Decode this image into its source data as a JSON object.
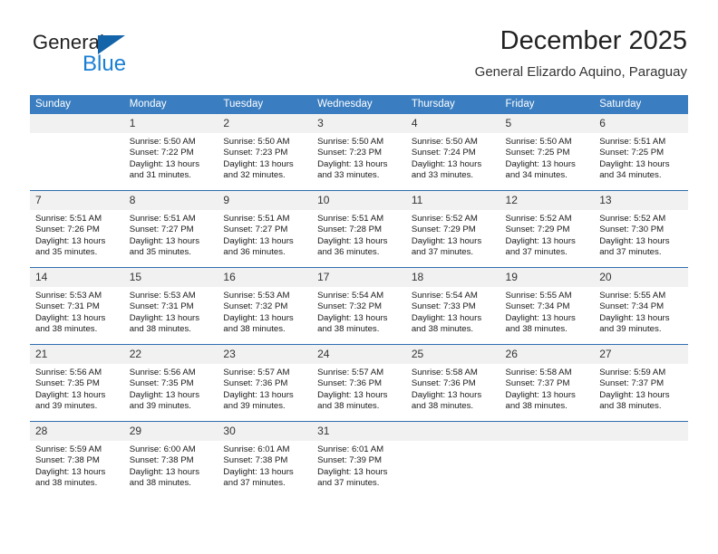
{
  "logo": {
    "word_one": "General",
    "word_two": "Blue",
    "triangle_color": "#1464aa",
    "blue_color": "#1a7fd4"
  },
  "header": {
    "title": "December 2025",
    "subtitle": "General Elizardo Aquino, Paraguay"
  },
  "theme": {
    "header_row_bg": "#3a7dc0",
    "daynum_bg": "#f1f1f1",
    "row_divider": "#2f6fb0"
  },
  "weekdays": [
    "Sunday",
    "Monday",
    "Tuesday",
    "Wednesday",
    "Thursday",
    "Friday",
    "Saturday"
  ],
  "weeks": [
    [
      {
        "day": "",
        "sunrise": "",
        "sunset": "",
        "daylight_line1": "",
        "daylight_line2": ""
      },
      {
        "day": "1",
        "sunrise": "Sunrise: 5:50 AM",
        "sunset": "Sunset: 7:22 PM",
        "daylight_line1": "Daylight: 13 hours",
        "daylight_line2": "and 31 minutes."
      },
      {
        "day": "2",
        "sunrise": "Sunrise: 5:50 AM",
        "sunset": "Sunset: 7:23 PM",
        "daylight_line1": "Daylight: 13 hours",
        "daylight_line2": "and 32 minutes."
      },
      {
        "day": "3",
        "sunrise": "Sunrise: 5:50 AM",
        "sunset": "Sunset: 7:23 PM",
        "daylight_line1": "Daylight: 13 hours",
        "daylight_line2": "and 33 minutes."
      },
      {
        "day": "4",
        "sunrise": "Sunrise: 5:50 AM",
        "sunset": "Sunset: 7:24 PM",
        "daylight_line1": "Daylight: 13 hours",
        "daylight_line2": "and 33 minutes."
      },
      {
        "day": "5",
        "sunrise": "Sunrise: 5:50 AM",
        "sunset": "Sunset: 7:25 PM",
        "daylight_line1": "Daylight: 13 hours",
        "daylight_line2": "and 34 minutes."
      },
      {
        "day": "6",
        "sunrise": "Sunrise: 5:51 AM",
        "sunset": "Sunset: 7:25 PM",
        "daylight_line1": "Daylight: 13 hours",
        "daylight_line2": "and 34 minutes."
      }
    ],
    [
      {
        "day": "7",
        "sunrise": "Sunrise: 5:51 AM",
        "sunset": "Sunset: 7:26 PM",
        "daylight_line1": "Daylight: 13 hours",
        "daylight_line2": "and 35 minutes."
      },
      {
        "day": "8",
        "sunrise": "Sunrise: 5:51 AM",
        "sunset": "Sunset: 7:27 PM",
        "daylight_line1": "Daylight: 13 hours",
        "daylight_line2": "and 35 minutes."
      },
      {
        "day": "9",
        "sunrise": "Sunrise: 5:51 AM",
        "sunset": "Sunset: 7:27 PM",
        "daylight_line1": "Daylight: 13 hours",
        "daylight_line2": "and 36 minutes."
      },
      {
        "day": "10",
        "sunrise": "Sunrise: 5:51 AM",
        "sunset": "Sunset: 7:28 PM",
        "daylight_line1": "Daylight: 13 hours",
        "daylight_line2": "and 36 minutes."
      },
      {
        "day": "11",
        "sunrise": "Sunrise: 5:52 AM",
        "sunset": "Sunset: 7:29 PM",
        "daylight_line1": "Daylight: 13 hours",
        "daylight_line2": "and 37 minutes."
      },
      {
        "day": "12",
        "sunrise": "Sunrise: 5:52 AM",
        "sunset": "Sunset: 7:29 PM",
        "daylight_line1": "Daylight: 13 hours",
        "daylight_line2": "and 37 minutes."
      },
      {
        "day": "13",
        "sunrise": "Sunrise: 5:52 AM",
        "sunset": "Sunset: 7:30 PM",
        "daylight_line1": "Daylight: 13 hours",
        "daylight_line2": "and 37 minutes."
      }
    ],
    [
      {
        "day": "14",
        "sunrise": "Sunrise: 5:53 AM",
        "sunset": "Sunset: 7:31 PM",
        "daylight_line1": "Daylight: 13 hours",
        "daylight_line2": "and 38 minutes."
      },
      {
        "day": "15",
        "sunrise": "Sunrise: 5:53 AM",
        "sunset": "Sunset: 7:31 PM",
        "daylight_line1": "Daylight: 13 hours",
        "daylight_line2": "and 38 minutes."
      },
      {
        "day": "16",
        "sunrise": "Sunrise: 5:53 AM",
        "sunset": "Sunset: 7:32 PM",
        "daylight_line1": "Daylight: 13 hours",
        "daylight_line2": "and 38 minutes."
      },
      {
        "day": "17",
        "sunrise": "Sunrise: 5:54 AM",
        "sunset": "Sunset: 7:32 PM",
        "daylight_line1": "Daylight: 13 hours",
        "daylight_line2": "and 38 minutes."
      },
      {
        "day": "18",
        "sunrise": "Sunrise: 5:54 AM",
        "sunset": "Sunset: 7:33 PM",
        "daylight_line1": "Daylight: 13 hours",
        "daylight_line2": "and 38 minutes."
      },
      {
        "day": "19",
        "sunrise": "Sunrise: 5:55 AM",
        "sunset": "Sunset: 7:34 PM",
        "daylight_line1": "Daylight: 13 hours",
        "daylight_line2": "and 38 minutes."
      },
      {
        "day": "20",
        "sunrise": "Sunrise: 5:55 AM",
        "sunset": "Sunset: 7:34 PM",
        "daylight_line1": "Daylight: 13 hours",
        "daylight_line2": "and 39 minutes."
      }
    ],
    [
      {
        "day": "21",
        "sunrise": "Sunrise: 5:56 AM",
        "sunset": "Sunset: 7:35 PM",
        "daylight_line1": "Daylight: 13 hours",
        "daylight_line2": "and 39 minutes."
      },
      {
        "day": "22",
        "sunrise": "Sunrise: 5:56 AM",
        "sunset": "Sunset: 7:35 PM",
        "daylight_line1": "Daylight: 13 hours",
        "daylight_line2": "and 39 minutes."
      },
      {
        "day": "23",
        "sunrise": "Sunrise: 5:57 AM",
        "sunset": "Sunset: 7:36 PM",
        "daylight_line1": "Daylight: 13 hours",
        "daylight_line2": "and 39 minutes."
      },
      {
        "day": "24",
        "sunrise": "Sunrise: 5:57 AM",
        "sunset": "Sunset: 7:36 PM",
        "daylight_line1": "Daylight: 13 hours",
        "daylight_line2": "and 38 minutes."
      },
      {
        "day": "25",
        "sunrise": "Sunrise: 5:58 AM",
        "sunset": "Sunset: 7:36 PM",
        "daylight_line1": "Daylight: 13 hours",
        "daylight_line2": "and 38 minutes."
      },
      {
        "day": "26",
        "sunrise": "Sunrise: 5:58 AM",
        "sunset": "Sunset: 7:37 PM",
        "daylight_line1": "Daylight: 13 hours",
        "daylight_line2": "and 38 minutes."
      },
      {
        "day": "27",
        "sunrise": "Sunrise: 5:59 AM",
        "sunset": "Sunset: 7:37 PM",
        "daylight_line1": "Daylight: 13 hours",
        "daylight_line2": "and 38 minutes."
      }
    ],
    [
      {
        "day": "28",
        "sunrise": "Sunrise: 5:59 AM",
        "sunset": "Sunset: 7:38 PM",
        "daylight_line1": "Daylight: 13 hours",
        "daylight_line2": "and 38 minutes."
      },
      {
        "day": "29",
        "sunrise": "Sunrise: 6:00 AM",
        "sunset": "Sunset: 7:38 PM",
        "daylight_line1": "Daylight: 13 hours",
        "daylight_line2": "and 38 minutes."
      },
      {
        "day": "30",
        "sunrise": "Sunrise: 6:01 AM",
        "sunset": "Sunset: 7:38 PM",
        "daylight_line1": "Daylight: 13 hours",
        "daylight_line2": "and 37 minutes."
      },
      {
        "day": "31",
        "sunrise": "Sunrise: 6:01 AM",
        "sunset": "Sunset: 7:39 PM",
        "daylight_line1": "Daylight: 13 hours",
        "daylight_line2": "and 37 minutes."
      },
      {
        "day": "",
        "sunrise": "",
        "sunset": "",
        "daylight_line1": "",
        "daylight_line2": ""
      },
      {
        "day": "",
        "sunrise": "",
        "sunset": "",
        "daylight_line1": "",
        "daylight_line2": ""
      },
      {
        "day": "",
        "sunrise": "",
        "sunset": "",
        "daylight_line1": "",
        "daylight_line2": ""
      }
    ]
  ]
}
